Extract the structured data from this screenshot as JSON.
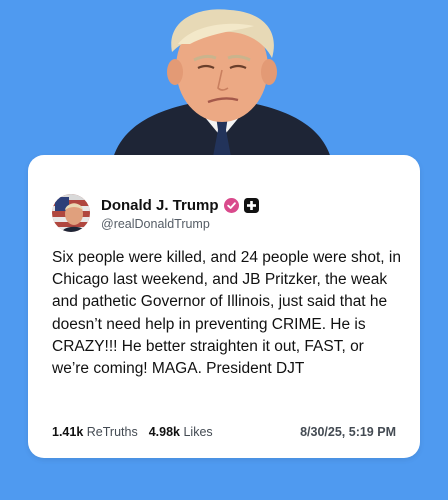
{
  "post": {
    "display_name": "Donald J. Trump",
    "handle": "@realDonaldTrump",
    "text": "Six people were killed, and 24 people were shot, in Chicago last weekend, and JB Pritzker, the weak and pathetic Governor of Illinois, just said that he doesn’t need help in preventing CRIME. He is CRAZY!!! He better straighten it out, FAST, or we’re coming! MAGA. President DJT",
    "retruths_count": "1.41k",
    "retruths_label": "ReTruths",
    "likes_count": "4.98k",
    "likes_label": "Likes",
    "timestamp": "8/30/25, 5:19 PM"
  },
  "icons": {
    "verified": "verified-badge-icon",
    "platform": "truth-social-icon"
  },
  "colors": {
    "background": "#4f9af0",
    "card": "#ffffff",
    "verified_badge": "#d94a8c",
    "text_primary": "#111111",
    "text_secondary": "#555d66"
  }
}
